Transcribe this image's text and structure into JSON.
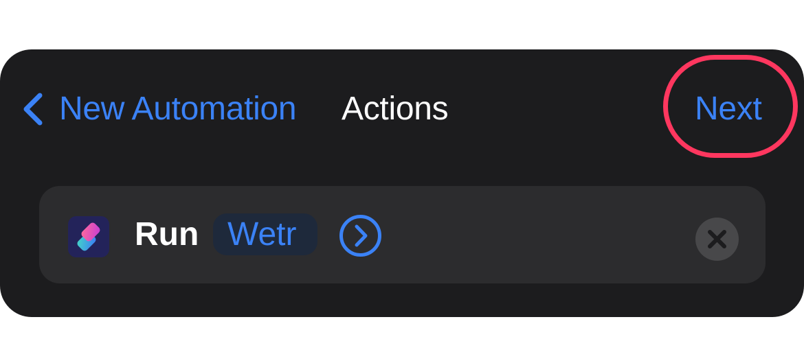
{
  "nav": {
    "back_label": "New Automation",
    "title": "Actions",
    "next_label": "Next"
  },
  "action": {
    "verb": "Run",
    "parameter": "Wetr"
  },
  "colors": {
    "background": "#1c1c1e",
    "card": "#2c2c2e",
    "accent": "#3b82f6",
    "highlight": "#ff375f"
  },
  "icons": {
    "back": "chevron-left-icon",
    "app": "shortcuts-app-icon",
    "detail": "chevron-right-circle-icon",
    "delete": "xmark-circle-icon"
  }
}
